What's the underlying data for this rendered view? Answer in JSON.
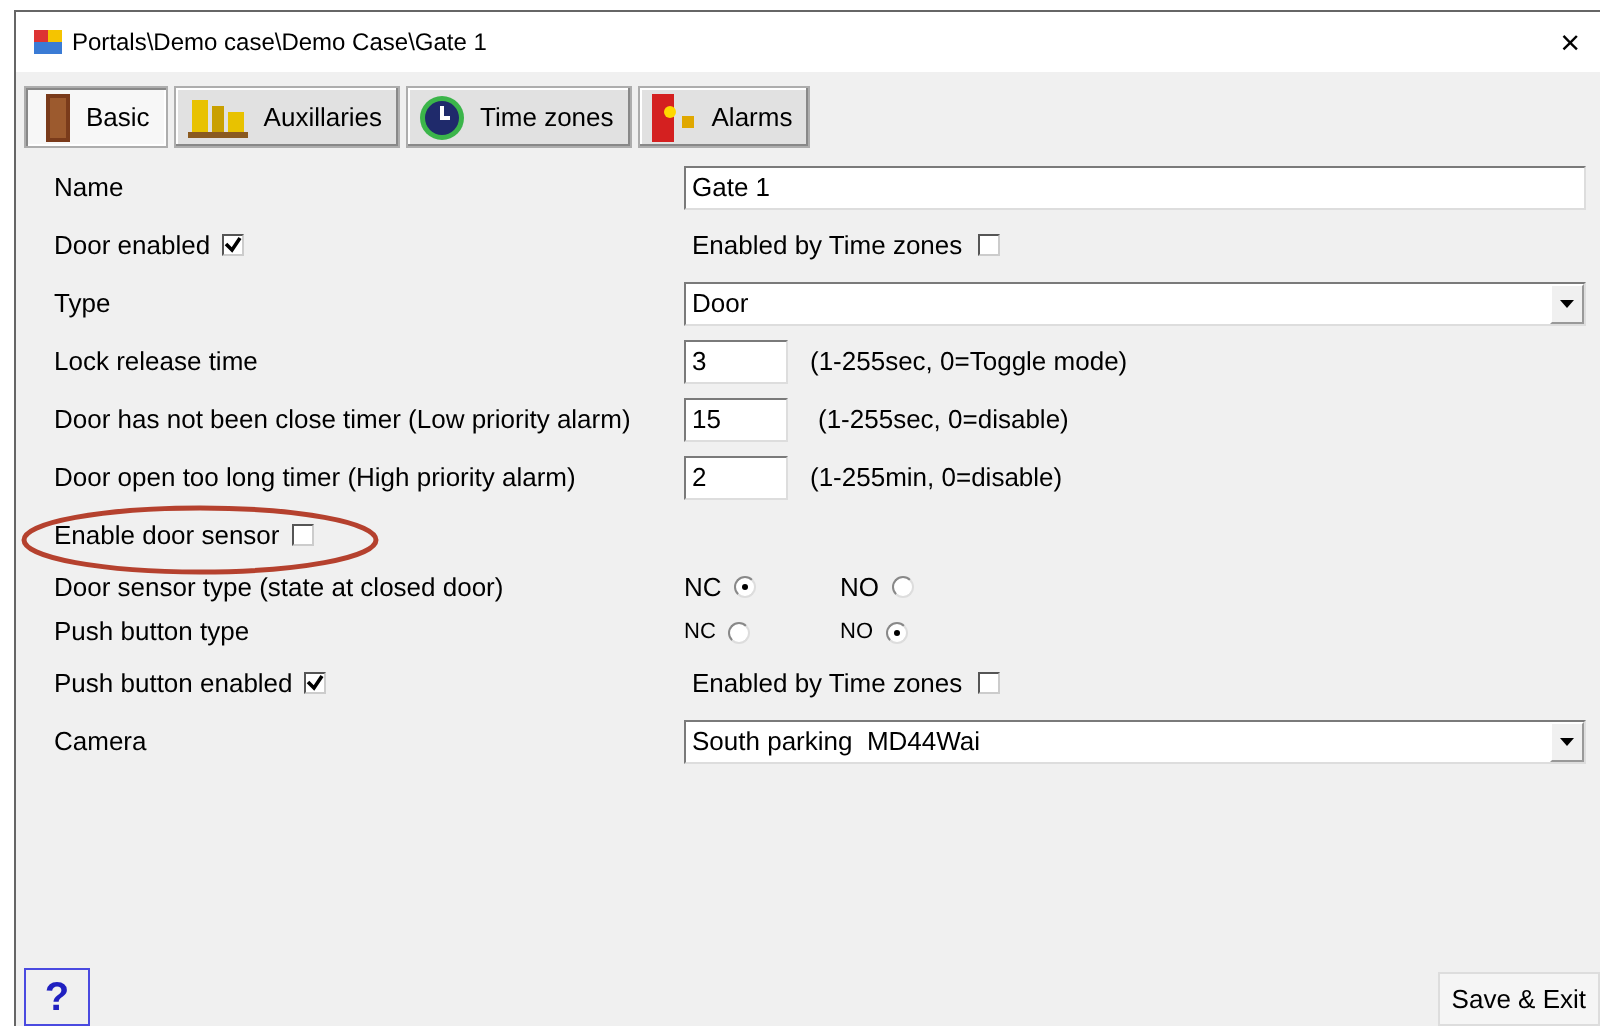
{
  "window": {
    "title": "Portals\\Demo case\\Demo Case\\Gate 1",
    "close": "×"
  },
  "tabs": [
    {
      "label": "Basic",
      "selected": true,
      "kind": "door"
    },
    {
      "label": "Auxillaries",
      "selected": false,
      "kind": "aux"
    },
    {
      "label": "Time zones",
      "selected": false,
      "kind": "clock"
    },
    {
      "label": "Alarms",
      "selected": false,
      "kind": "alarm"
    }
  ],
  "rows": [
    {
      "kind": "text",
      "label": "Name",
      "value": "Gate 1"
    },
    {
      "kind": "checks",
      "label": "Door enabled",
      "checked": true,
      "right_label": "Enabled by Time zones",
      "right_checked": false
    },
    {
      "kind": "select",
      "label": "Type",
      "value": "Door"
    },
    {
      "kind": "number",
      "label": "Lock release time",
      "value": "3",
      "note": "(1-255sec, 0=Toggle mode)"
    },
    {
      "kind": "number",
      "label": "Door has not been close timer (Low priority alarm)",
      "value": "15",
      "note": "(1-255sec, 0=disable)"
    },
    {
      "kind": "number",
      "label": "Door open too long timer (High priority alarm)",
      "value": "2",
      "note": "(1-255min, 0=disable)"
    },
    {
      "kind": "checks",
      "label": "Enable door sensor",
      "checked": false,
      "highlighted": true
    },
    {
      "kind": "radios",
      "label": "Door sensor type (state at closed door)",
      "options": [
        {
          "label": "NC",
          "selected": true
        },
        {
          "label": "NO",
          "selected": false
        }
      ]
    },
    {
      "kind": "radios",
      "label": "Push button type",
      "small": true,
      "options": [
        {
          "label": "NC",
          "selected": false
        },
        {
          "label": "NO",
          "selected": true
        }
      ]
    },
    {
      "kind": "checks",
      "label": "Push button enabled",
      "checked": true,
      "right_label": "Enabled by Time zones",
      "right_checked": false
    },
    {
      "kind": "select",
      "label": "Camera",
      "value": "South parking  MD44Wai"
    }
  ],
  "help_button": "?",
  "save_button": "Save & Exit"
}
